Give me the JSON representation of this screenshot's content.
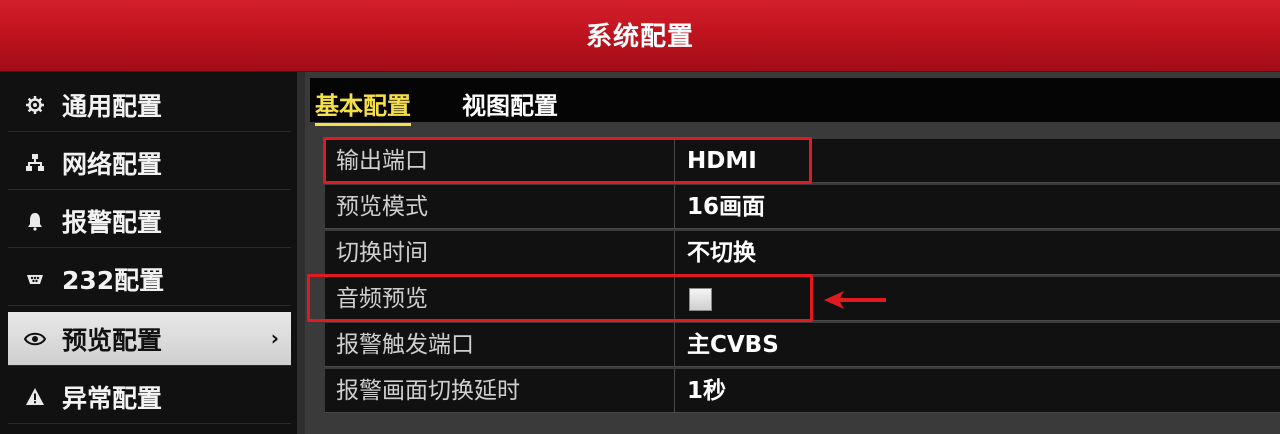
{
  "window": {
    "title": "系统配置"
  },
  "sidebar": {
    "items": [
      {
        "label": "通用配置",
        "icon": "gear-icon"
      },
      {
        "label": "网络配置",
        "icon": "network-icon"
      },
      {
        "label": "报警配置",
        "icon": "alarm-bell-icon"
      },
      {
        "label": "232配置",
        "icon": "serial-port-icon"
      },
      {
        "label": "预览配置",
        "icon": "eye-icon",
        "active": true
      },
      {
        "label": "异常配置",
        "icon": "warning-icon"
      }
    ],
    "active_chevron": "›"
  },
  "tabs": [
    {
      "label": "基本配置",
      "active": true
    },
    {
      "label": "视图配置",
      "active": false
    }
  ],
  "settings": {
    "rows": [
      {
        "label": "输出端口",
        "value": "HDMI"
      },
      {
        "label": "预览模式",
        "value": "16画面"
      },
      {
        "label": "切换时间",
        "value": "不切换"
      },
      {
        "label": "音频预览",
        "value": "",
        "type": "checkbox",
        "checked": false
      },
      {
        "label": "报警触发端口",
        "value": "主CVBS"
      },
      {
        "label": "报警画面切换延时",
        "value": "1秒"
      }
    ]
  },
  "colors": {
    "title_bar": "#c0141f",
    "active_tab": "#f6e04a",
    "highlight": "#e01a20"
  }
}
